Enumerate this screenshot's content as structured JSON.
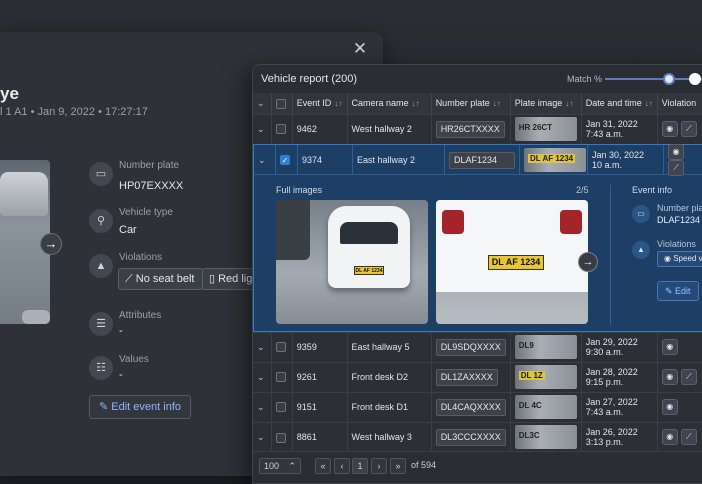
{
  "detail": {
    "title_fragment": "ye",
    "sub_fragment": "l 1 A1",
    "date": "Jan 9, 2022",
    "time": "17:27:17",
    "fields": [
      {
        "label": "Number plate",
        "value": "HP07EXXXX"
      },
      {
        "label": "Vehicle type",
        "value": "Car"
      },
      {
        "label": "Violations",
        "value": ""
      },
      {
        "label": "Attributes",
        "value": "-"
      },
      {
        "label": "Values",
        "value": "-"
      }
    ],
    "violation_chips": [
      "No seat belt",
      "Red lig"
    ],
    "edit_label": "Edit event info"
  },
  "report": {
    "title": "Vehicle report (200)",
    "match_label": "Match %",
    "columns": [
      "Event ID",
      "Camera name",
      "Number plate",
      "Plate image",
      "Date and time",
      "Violation"
    ],
    "rows": [
      {
        "id": "9462",
        "camera": "West hallway 2",
        "plate": "HR26CTXXXX",
        "pimg": "HR 26CT",
        "date": "Jan 31, 2022",
        "time": "7:43 a.m.",
        "v": 2
      },
      {
        "id": "9374",
        "camera": "East hallway 2",
        "plate": "DLAF1234",
        "pimg": "DL AF 1234",
        "date": "Jan 30, 2022",
        "time": "10 a.m.",
        "v": 2
      },
      {
        "id": "9359",
        "camera": "East hallway 5",
        "plate": "DL9SDQXXXX",
        "pimg": "DL9",
        "date": "Jan 29, 2022",
        "time": "9:30 a.m.",
        "v": 1
      },
      {
        "id": "9261",
        "camera": "Front desk D2",
        "plate": "DL1ZAXXXX",
        "pimg": "DL 1Z",
        "date": "Jan 28, 2022",
        "time": "9:15 p.m.",
        "v": 2
      },
      {
        "id": "9151",
        "camera": "Front desk D1",
        "plate": "DL4CAQXXXX",
        "pimg": "DL 4C",
        "date": "Jan 27, 2022",
        "time": "7:43 a.m.",
        "v": 1
      },
      {
        "id": "8861",
        "camera": "West hallway 3",
        "plate": "DL3CCCXXXX",
        "pimg": "DL3C",
        "date": "Jan 26, 2022",
        "time": "3:13 p.m.",
        "v": 2
      }
    ],
    "expanded": {
      "full_images_label": "Full images",
      "counter": "2/5",
      "event_info_label": "Event info",
      "number_plate_label": "Number plate",
      "number_plate_value": "DLAF1234",
      "violations_label": "Violations",
      "violation_chip": "Speed vi",
      "edit_label": "Edit",
      "plate_text_small": "DL AF 1234",
      "plate_text_big": "DL AF 1234"
    },
    "pager": {
      "page_size": "100",
      "page": "1",
      "of_label": "of 594"
    }
  }
}
